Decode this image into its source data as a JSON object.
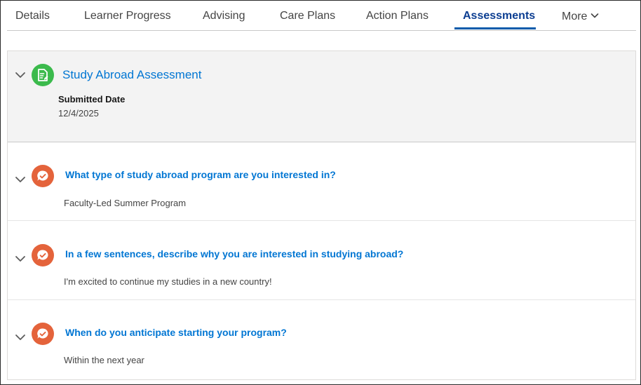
{
  "tabs": [
    {
      "label": "Details",
      "active": false
    },
    {
      "label": "Learner Progress",
      "active": false
    },
    {
      "label": "Advising",
      "active": false
    },
    {
      "label": "Care Plans",
      "active": false
    },
    {
      "label": "Action Plans",
      "active": false
    },
    {
      "label": "Assessments",
      "active": true
    },
    {
      "label": "More",
      "active": false
    }
  ],
  "assessment": {
    "title": "Study Abroad Assessment",
    "submitted_date_label": "Submitted Date",
    "submitted_date_value": "12/4/2025",
    "icon": "assessment-document-icon",
    "icon_color": "#3bba4c"
  },
  "questions": [
    {
      "question": "What type of study abroad program are you interested in?",
      "answer": "Faculty-Led Summer Program"
    },
    {
      "question": "In a few sentences, describe why you are interested in studying abroad?",
      "answer": "I'm excited to continue my studies in a new country!"
    },
    {
      "question": "When do you anticipate starting your program?",
      "answer": "Within the next year"
    }
  ],
  "colors": {
    "accent": "#0176d3",
    "active_tab": "#0b3d91",
    "question_icon": "#e4633b"
  }
}
